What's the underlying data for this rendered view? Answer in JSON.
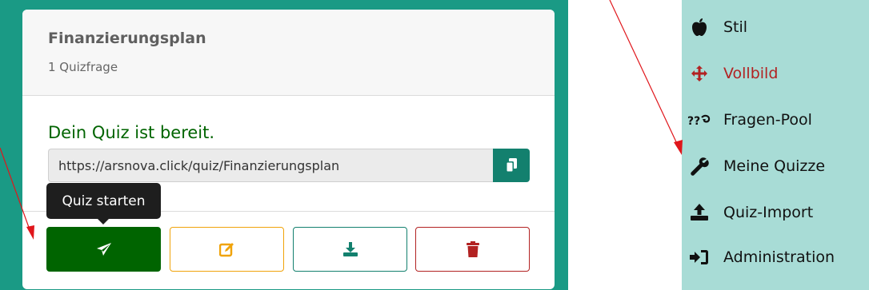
{
  "quiz_card": {
    "title": "Finanzierungsplan",
    "subtitle": "1 Quizfrage",
    "ready_message": "Dein Quiz ist bereit.",
    "url": "https://arsnova.click/quiz/Finanzierungsplan",
    "tooltip": "Quiz starten",
    "buttons": {
      "start_icon": "paper-plane-icon",
      "edit_icon": "edit-icon",
      "export_icon": "download-icon",
      "delete_icon": "trash-icon",
      "copy_icon": "copy-icon"
    }
  },
  "menu": {
    "items": [
      {
        "label": "Stil",
        "icon": "apple-icon"
      },
      {
        "label": "Vollbild",
        "icon": "arrows-move-icon",
        "active": true
      },
      {
        "label": "Fragen-Pool",
        "icon": "question-pool-icon"
      },
      {
        "label": "Meine Quizze",
        "icon": "wrench-icon"
      },
      {
        "label": "Quiz-Import",
        "icon": "upload-icon"
      },
      {
        "label": "Administration",
        "icon": "sign-in-icon"
      }
    ]
  },
  "colors": {
    "frame": "#1a9a85",
    "start": "#006400",
    "edit": "#f0a30a",
    "export": "#13806e",
    "delete": "#b22222",
    "menu_bg": "#a8dcd6",
    "active_menu": "#b22222",
    "annotation_arrow": "#e0161b"
  }
}
